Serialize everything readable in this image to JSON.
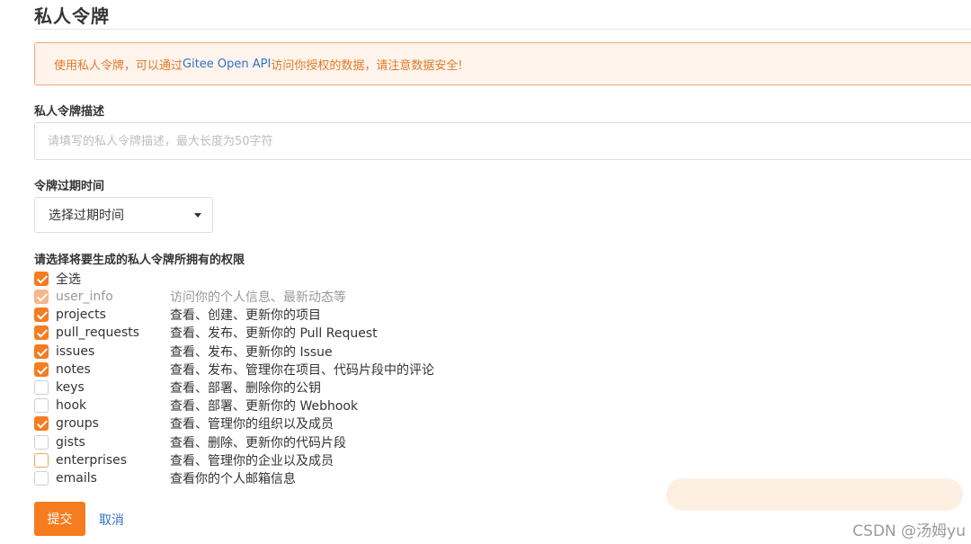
{
  "page": {
    "title": "私人令牌"
  },
  "alert": {
    "prefix": "使用私人令牌，可以通过 ",
    "api_text": "Gitee Open API",
    "suffix": " 访问你授权的数据，请注意数据安全!"
  },
  "description": {
    "label": "私人令牌描述",
    "value": "",
    "placeholder": "请填写的私人令牌描述，最大长度为50字符"
  },
  "expiration": {
    "label": "令牌过期时间",
    "selected": "选择过期时间"
  },
  "permissions": {
    "label": "请选择将要生成的私人令牌所拥有的权限",
    "select_all": {
      "label": "全选",
      "checked": true
    },
    "items": [
      {
        "name": "user_info",
        "desc": "访问你的个人信息、最新动态等",
        "checked": true,
        "disabled": true
      },
      {
        "name": "projects",
        "desc": "查看、创建、更新你的项目",
        "checked": true,
        "disabled": false
      },
      {
        "name": "pull_requests",
        "desc": "查看、发布、更新你的 Pull Request",
        "checked": true,
        "disabled": false
      },
      {
        "name": "issues",
        "desc": "查看、发布、更新你的 Issue",
        "checked": true,
        "disabled": false
      },
      {
        "name": "notes",
        "desc": "查看、发布、管理你在项目、代码片段中的评论",
        "checked": true,
        "disabled": false
      },
      {
        "name": "keys",
        "desc": "查看、部署、删除你的公钥",
        "checked": false,
        "disabled": false
      },
      {
        "name": "hook",
        "desc": "查看、部署、更新你的 Webhook",
        "checked": false,
        "disabled": false
      },
      {
        "name": "groups",
        "desc": "查看、管理你的组织以及成员",
        "checked": true,
        "disabled": false
      },
      {
        "name": "gists",
        "desc": "查看、删除、更新你的代码片段",
        "checked": false,
        "disabled": false
      },
      {
        "name": "enterprises",
        "desc": "查看、管理你的企业以及成员",
        "checked": false,
        "disabled": false,
        "focused": true
      },
      {
        "name": "emails",
        "desc": "查看你的个人邮箱信息",
        "checked": false,
        "disabled": false
      }
    ]
  },
  "actions": {
    "submit": "提交",
    "cancel": "取消"
  },
  "watermark": "CSDN @汤姆yu",
  "colors": {
    "accent": "#f57c1f",
    "link": "#2e72c7",
    "alert_bg": "#fff4ec",
    "alert_text": "#e07a2a"
  }
}
